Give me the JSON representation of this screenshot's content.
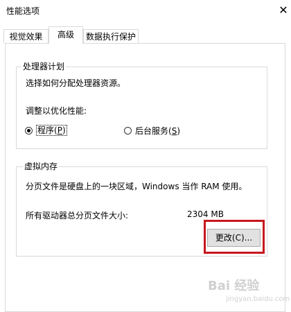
{
  "window": {
    "title": "性能选项",
    "close_glyph": "✕"
  },
  "tabs": [
    {
      "label": "视觉效果",
      "selected": false
    },
    {
      "label": "高级",
      "selected": true
    },
    {
      "label": "数据执行保护",
      "selected": false
    }
  ],
  "processor_scheduling": {
    "title": "处理器计划",
    "description": "选择如何分配处理器资源。",
    "adjust_label": "调整以优化性能:",
    "options": [
      {
        "label": "程序",
        "accel": "P",
        "checked": true
      },
      {
        "label": "后台服务",
        "accel": "S",
        "checked": false
      }
    ]
  },
  "virtual_memory": {
    "title": "虚拟内存",
    "description": "分页文件是硬盘上的一块区域，Windows 当作 RAM 使用。",
    "total_label": "所有驱动器总分页文件大小:",
    "total_value": "2304 MB",
    "change_button": "更改(C)..."
  },
  "watermark": {
    "text": "Bai 经验",
    "sub": "jingyan.baidu.com"
  },
  "colors": {
    "highlight": "#c8161d",
    "border": "#d9d9d9",
    "button_bg": "#e1e1e1"
  }
}
